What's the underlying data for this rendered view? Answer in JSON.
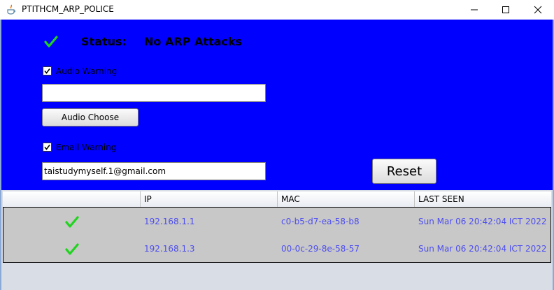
{
  "window": {
    "title": "PTITHCM_ARP_POLICE",
    "controls": [
      "minimize",
      "maximize",
      "close"
    ]
  },
  "status": {
    "icon": "check-icon",
    "label": "Status:",
    "value": "No ARP Attacks"
  },
  "audio": {
    "checkbox_label": "Audio Warning",
    "checked": true,
    "field_value": "",
    "button_label": "Audio Choose"
  },
  "email": {
    "checkbox_label": "Email Warning",
    "checked": true,
    "field_value": "taistudymyself.1@gmail.com"
  },
  "reset_label": "Reset",
  "table": {
    "headers": [
      "",
      "IP",
      "MAC",
      "LAST SEEN"
    ],
    "rows": [
      {
        "status_icon": "check-icon",
        "ip": "192.168.1.1",
        "mac": "c0-b5-d7-ea-58-b8",
        "last_seen": "Sun Mar 06 20:42:04 ICT 2022"
      },
      {
        "status_icon": "check-icon",
        "ip": "192.168.1.3",
        "mac": "00-0c-29-8e-58-57",
        "last_seen": "Sun Mar 06 20:42:04 ICT 2022"
      }
    ]
  },
  "colors": {
    "background": "#0000fe",
    "check_green": "#1fd41f",
    "table_text": "#4d4df0",
    "table_rows_bg": "#c8c8c8"
  }
}
